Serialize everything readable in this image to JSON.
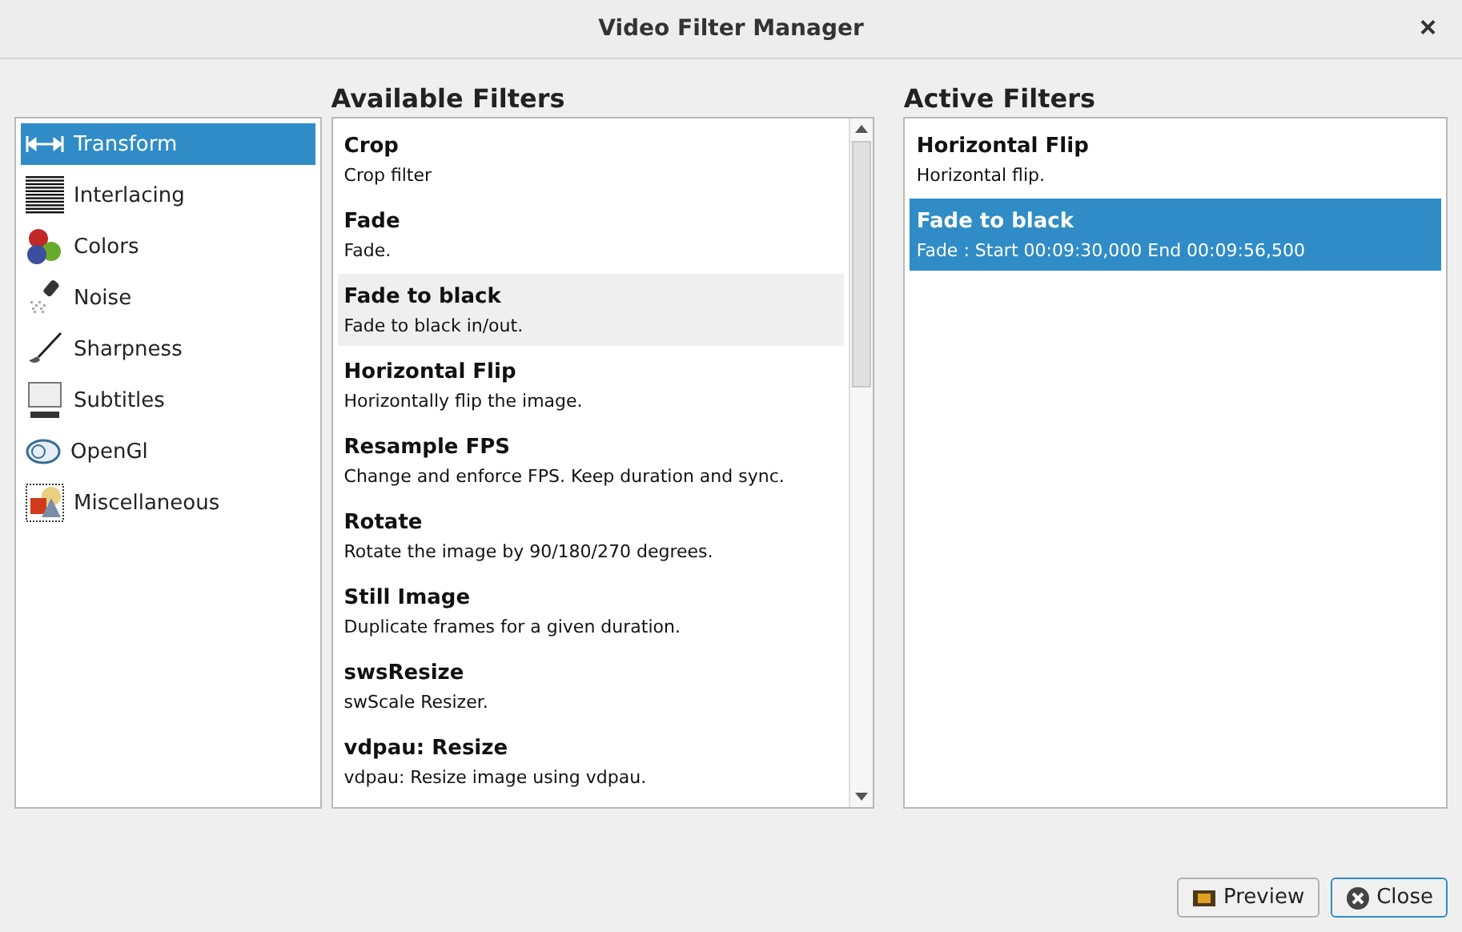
{
  "window": {
    "title": "Video Filter Manager",
    "close": "×"
  },
  "categories": [
    {
      "label": "Transform",
      "selected": true
    },
    {
      "label": "Interlacing",
      "selected": false
    },
    {
      "label": "Colors",
      "selected": false
    },
    {
      "label": "Noise",
      "selected": false
    },
    {
      "label": "Sharpness",
      "selected": false
    },
    {
      "label": "Subtitles",
      "selected": false
    },
    {
      "label": "OpenGl",
      "selected": false
    },
    {
      "label": "Miscellaneous",
      "selected": false
    }
  ],
  "available": {
    "heading": "Available Filters",
    "items": [
      {
        "name": "Crop",
        "description": "Crop filter",
        "selected": false
      },
      {
        "name": "Fade",
        "description": "Fade.",
        "selected": false
      },
      {
        "name": "Fade to black",
        "description": "Fade to black in/out.",
        "selected": true
      },
      {
        "name": "Horizontal Flip",
        "description": "Horizontally flip the image.",
        "selected": false
      },
      {
        "name": "Resample FPS",
        "description": "Change and enforce FPS. Keep duration and sync.",
        "selected": false
      },
      {
        "name": "Rotate",
        "description": "Rotate the image by 90/180/270 degrees.",
        "selected": false
      },
      {
        "name": "Still Image",
        "description": "Duplicate frames for a given duration.",
        "selected": false
      },
      {
        "name": "swsResize",
        "description": "swScale Resizer.",
        "selected": false
      },
      {
        "name": "vdpau: Resize",
        "description": "vdpau: Resize image using vdpau.",
        "selected": false
      }
    ]
  },
  "active": {
    "heading": "Active Filters",
    "items": [
      {
        "name": "Horizontal Flip",
        "description": "Horizontal flip.",
        "selected": false
      },
      {
        "name": "Fade to black",
        "description": "Fade : Start 00:09:30,000 End 00:09:56,500",
        "selected": true
      }
    ]
  },
  "buttons": [
    "Preview",
    "Close"
  ]
}
